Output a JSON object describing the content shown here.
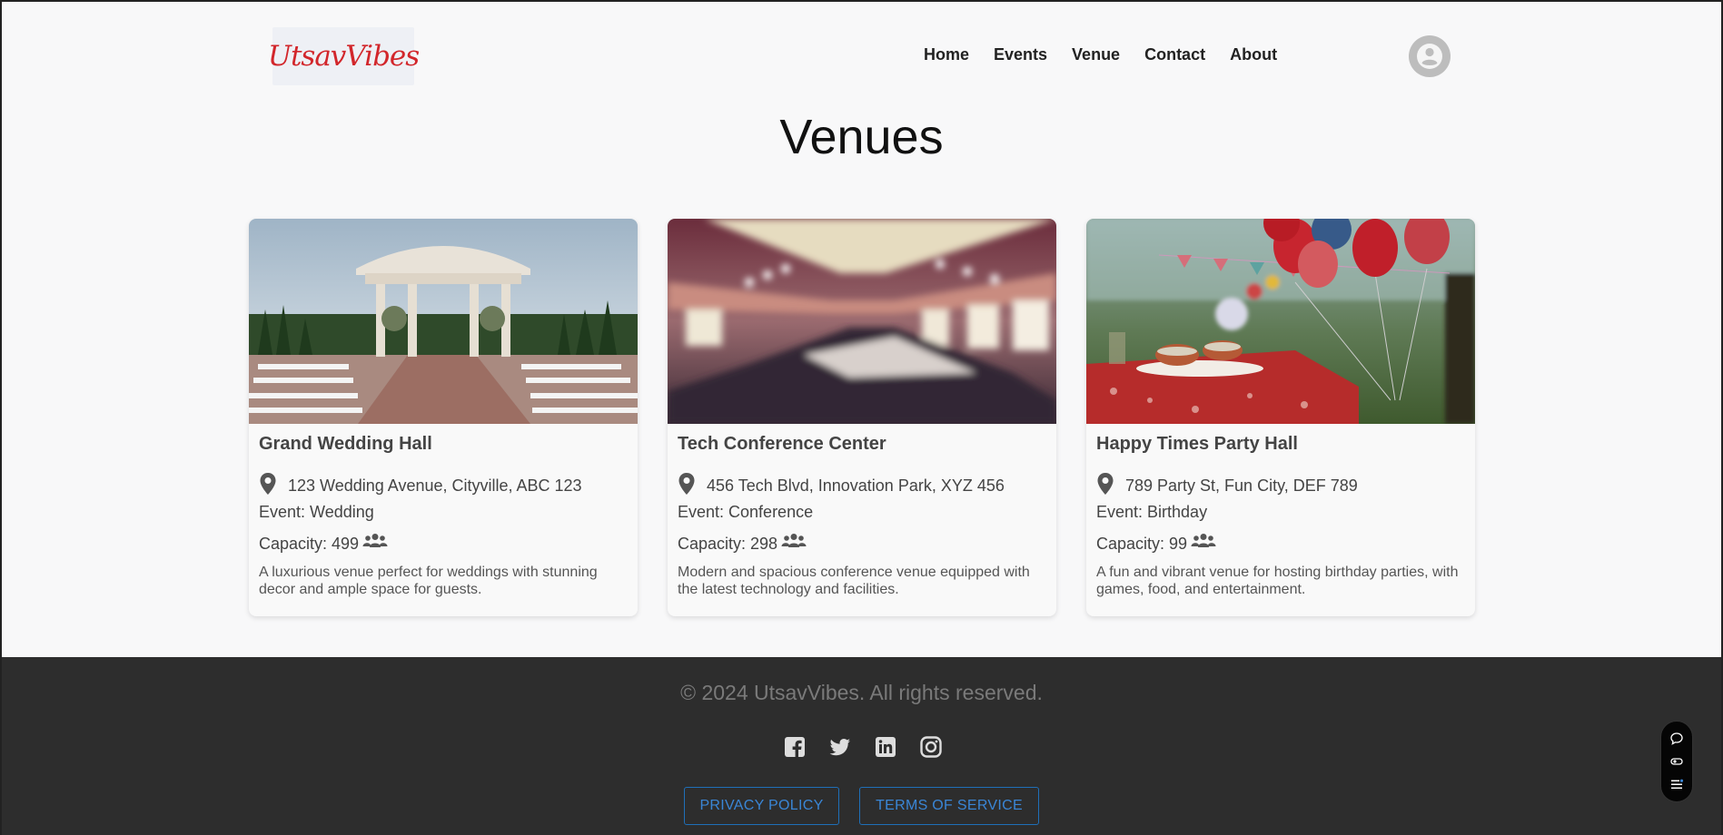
{
  "header": {
    "logo_text": "UtsavVibes",
    "nav": [
      "Home",
      "Events",
      "Venue",
      "Contact",
      "About"
    ]
  },
  "page_title": "Venues",
  "venues": [
    {
      "name": "Grand Wedding Hall",
      "address": "123 Wedding Avenue, Cityville, ABC 123",
      "event": "Event: Wedding",
      "capacity": "Capacity: 499",
      "description": "A luxurious venue perfect for weddings with stunning decor and ample space for guests.",
      "image": "wedding-gazebo-photo"
    },
    {
      "name": "Tech Conference Center",
      "address": "456 Tech Blvd, Innovation Park, XYZ 456",
      "event": "Event: Conference",
      "capacity": "Capacity: 298",
      "description": "Modern and spacious conference venue equipped with the latest technology and facilities.",
      "image": "blurred-conference-hall-photo"
    },
    {
      "name": "Happy Times Party Hall",
      "address": "789 Party St, Fun City, DEF 789",
      "event": "Event: Birthday",
      "capacity": "Capacity: 99",
      "description": "A fun and vibrant venue for hosting birthday parties, with games, food, and entertainment.",
      "image": "birthday-balloons-table-photo"
    }
  ],
  "footer": {
    "copyright": "© 2024 UtsavVibes. All rights reserved.",
    "social_icons": [
      "facebook-icon",
      "twitter-icon",
      "linkedin-icon",
      "instagram-icon"
    ],
    "privacy_label": "PRIVACY POLICY",
    "terms_label": "TERMS OF SERVICE"
  },
  "colors": {
    "brand_red": "#d2262b",
    "footer_bg": "#2d2d2d",
    "link_blue": "#3a86d6",
    "page_bg": "#f8f8f9"
  }
}
